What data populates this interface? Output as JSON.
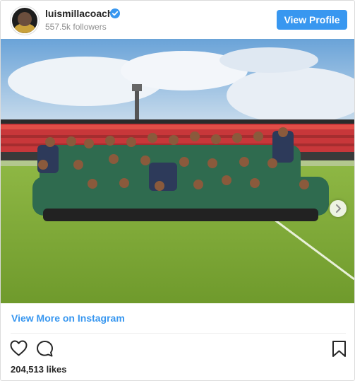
{
  "header": {
    "username": "luismillacoach",
    "followers": "557.5k followers",
    "view_profile_label": "View Profile"
  },
  "post": {
    "photo_alt": "Team photo on a football pitch"
  },
  "footer": {
    "view_more_label": "View More on Instagram",
    "likes": "204,513 likes"
  },
  "icons": {
    "verified": "verified-badge-icon",
    "like": "heart-icon",
    "comment": "comment-bubble-icon",
    "save": "bookmark-icon",
    "next": "chevron-right-icon"
  },
  "colors": {
    "accent": "#3897f0",
    "text": "#262626",
    "muted": "#8e8e8e"
  }
}
